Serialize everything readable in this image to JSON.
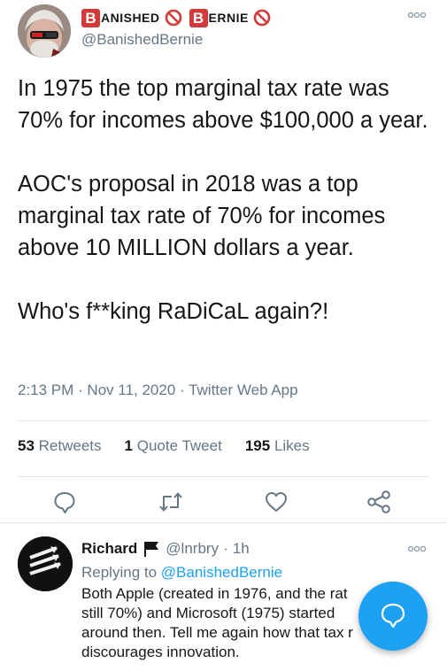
{
  "tweet": {
    "display_name": {
      "word1_initial": "B",
      "word1_rest": "ANISHED",
      "word2_initial": "B",
      "word2_rest": "ERNIE"
    },
    "handle": "@BanishedBernie",
    "paragraphs": [
      "In 1975 the top marginal tax rate was 70% for incomes above $100,000 a year.",
      "AOC's proposal in 2018 was a top marginal tax rate of 70% for incomes above 10 MILLION dollars a year.",
      "Who's f**king RaDiCaL again?!"
    ],
    "timestamp": "2:13 PM · Nov 11, 2020 · Twitter Web App",
    "stats": {
      "retweets_count": "53",
      "retweets_label": "Retweets",
      "quotes_count": "1",
      "quotes_label": "Quote Tweet",
      "likes_count": "195",
      "likes_label": "Likes"
    }
  },
  "reply": {
    "name": "Richard",
    "handle": "@lnrbry",
    "dot": "·",
    "time": "1h",
    "replying_prefix": "Replying to",
    "replying_to": "@BanishedBernie",
    "lines": [
      "Both Apple (created in 1976, and the rat",
      "still 70%) and Microsoft (1975) started",
      "around then. Tell me again how that tax r",
      "discourages innovation."
    ]
  },
  "icons": {
    "avatar_main": "profile-photo-icon",
    "ban": "prohibited-circle-icon",
    "more": "more-dots-icon",
    "reply": "comment-bubble-icon",
    "retweet": "retweet-icon",
    "like": "heart-icon",
    "share": "share-icon",
    "flag": "black-flag-icon",
    "avatar_reply": "arrows-logo-icon",
    "compose": "compose-reply-icon"
  },
  "colors": {
    "accent": "#1da1f2",
    "ban_red": "#d33a3a",
    "secondary_text": "#657786",
    "primary_text": "#14171a"
  }
}
